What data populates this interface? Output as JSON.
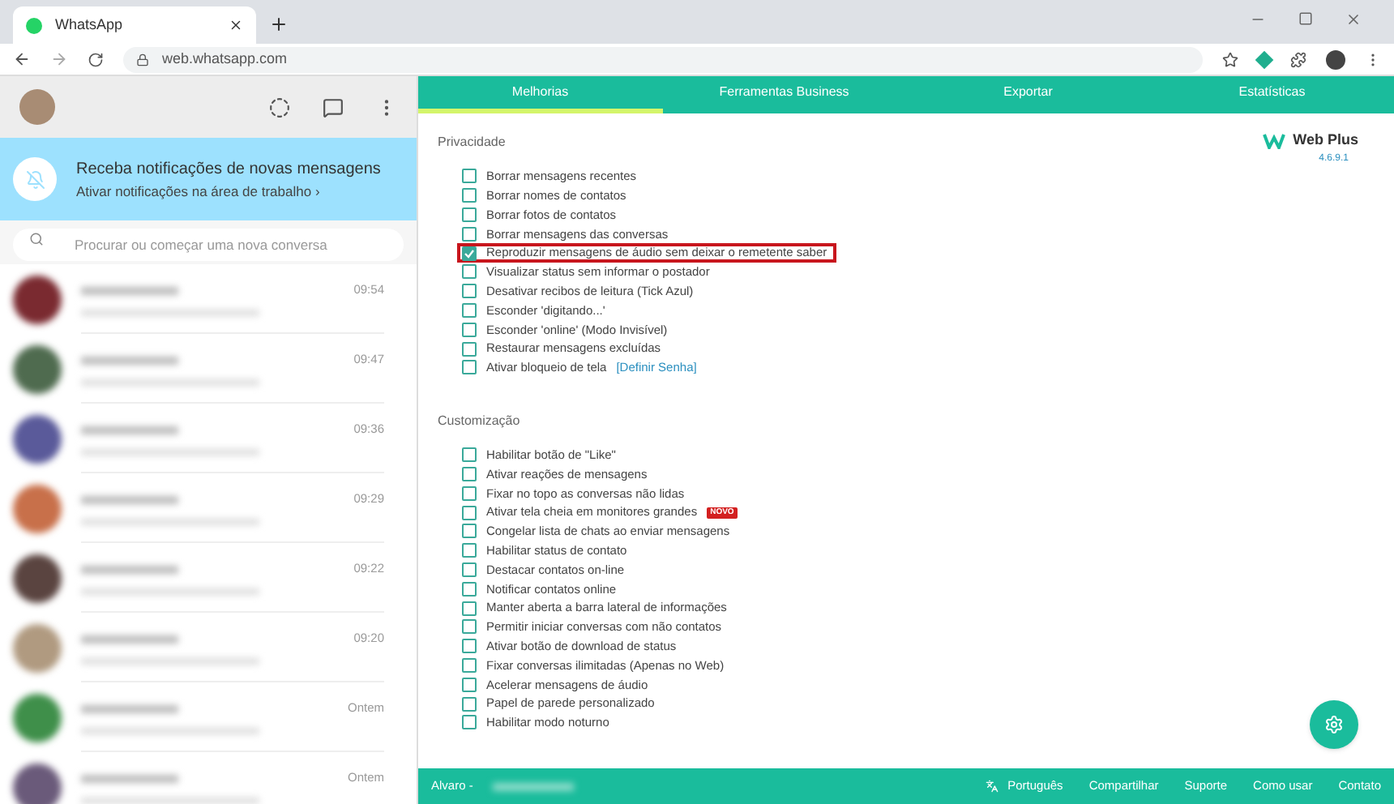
{
  "browser": {
    "tab_title": "WhatsApp",
    "url": "web.whatsapp.com"
  },
  "notification": {
    "title": "Receba notificações de novas mensagens",
    "link": "Ativar notificações na área de trabalho",
    "chevron": "›"
  },
  "search": {
    "placeholder": "Procurar ou começar uma nova conversa"
  },
  "chats": [
    {
      "time": "09:54"
    },
    {
      "time": "09:47"
    },
    {
      "time": "09:36"
    },
    {
      "time": "09:29"
    },
    {
      "time": "09:22"
    },
    {
      "time": "09:20"
    },
    {
      "time": "Ontem"
    },
    {
      "time": "Ontem"
    }
  ],
  "tabs": [
    {
      "label": "Melhorias",
      "selected": true
    },
    {
      "label": "Ferramentas Business",
      "selected": false
    },
    {
      "label": "Exportar",
      "selected": false
    },
    {
      "label": "Estatísticas",
      "selected": false
    }
  ],
  "logo": {
    "name": "Web Plus",
    "version": "4.6.9.1"
  },
  "sections": [
    {
      "title": "Privacidade",
      "options": [
        {
          "label": "Borrar mensagens recentes",
          "checked": false,
          "highlighted": false
        },
        {
          "label": "Borrar nomes de contatos",
          "checked": false,
          "highlighted": false
        },
        {
          "label": "Borrar fotos de contatos",
          "checked": false,
          "highlighted": false
        },
        {
          "label": "Borrar mensagens das conversas",
          "checked": false,
          "highlighted": false
        },
        {
          "label": "Reproduzir mensagens de áudio sem deixar o remetente saber",
          "checked": true,
          "highlighted": true
        },
        {
          "label": "Visualizar status sem informar o postador",
          "checked": false,
          "highlighted": false
        },
        {
          "label": "Desativar recibos de leitura (Tick Azul)",
          "checked": false,
          "highlighted": false
        },
        {
          "label": "Esconder 'digitando...'",
          "checked": false,
          "highlighted": false
        },
        {
          "label": "Esconder 'online' (Modo Invisível)",
          "checked": false,
          "highlighted": false
        },
        {
          "label": "Restaurar mensagens excluídas",
          "checked": false,
          "highlighted": false
        },
        {
          "label": "Ativar bloqueio de tela",
          "link": "[Definir Senha]",
          "checked": false,
          "highlighted": false
        }
      ]
    },
    {
      "title": "Customização",
      "options": [
        {
          "label": "Habilitar botão de \"Like\"",
          "checked": false,
          "highlighted": false
        },
        {
          "label": "Ativar reações de mensagens",
          "checked": false,
          "highlighted": false
        },
        {
          "label": "Fixar no topo as conversas não lidas",
          "checked": false,
          "highlighted": false
        },
        {
          "label": "Ativar tela cheia em monitores grandes",
          "badge": "NOVO",
          "checked": false,
          "highlighted": false
        },
        {
          "label": "Congelar lista de chats ao enviar mensagens",
          "checked": false,
          "highlighted": false
        },
        {
          "label": "Habilitar status de contato",
          "checked": false,
          "highlighted": false
        },
        {
          "label": "Destacar contatos on-line",
          "checked": false,
          "highlighted": false
        },
        {
          "label": "Notificar contatos online",
          "checked": false,
          "highlighted": false
        },
        {
          "label": "Manter aberta a barra lateral de informações",
          "checked": false,
          "highlighted": false
        },
        {
          "label": "Permitir iniciar conversas com não contatos",
          "checked": false,
          "highlighted": false
        },
        {
          "label": "Ativar botão de download de status",
          "checked": false,
          "highlighted": false
        },
        {
          "label": "Fixar conversas ilimitadas (Apenas no Web)",
          "checked": false,
          "highlighted": false
        },
        {
          "label": "Acelerar mensagens de áudio",
          "checked": false,
          "highlighted": false
        },
        {
          "label": "Papel de parede personalizado",
          "checked": false,
          "highlighted": false
        },
        {
          "label": "Habilitar modo noturno",
          "checked": false,
          "highlighted": false
        }
      ]
    }
  ],
  "footer": {
    "user": "Alvaro -",
    "links": [
      "Português",
      "Compartilhar",
      "Suporte",
      "Como usar",
      "Contato"
    ]
  }
}
